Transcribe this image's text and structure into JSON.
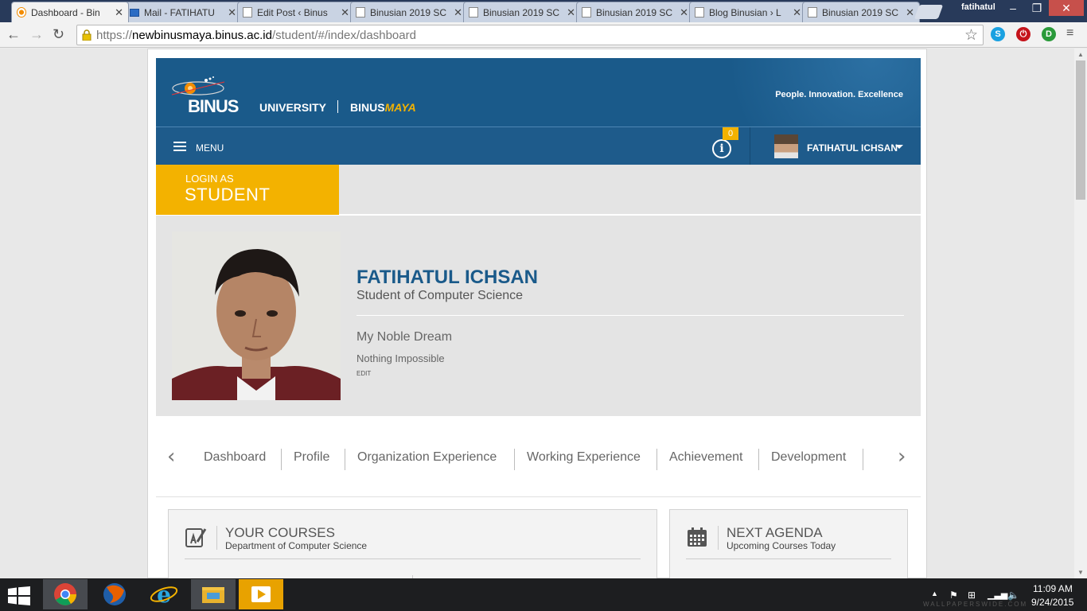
{
  "browser": {
    "tabs": [
      {
        "label": "Dashboard - Bin",
        "icon": "binus-favicon-icon",
        "active": true
      },
      {
        "label": "Mail - FATIHATU",
        "icon": "mail-favicon-icon"
      },
      {
        "label": "Edit Post ‹ Binus",
        "icon": "page-icon"
      },
      {
        "label": "Binusian 2019 SC",
        "icon": "page-icon"
      },
      {
        "label": "Binusian 2019 SC",
        "icon": "page-icon"
      },
      {
        "label": "Binusian 2019 SC",
        "icon": "page-icon"
      },
      {
        "label": "Blog Binusian › L",
        "icon": "page-icon"
      },
      {
        "label": "Binusian 2019 SC",
        "icon": "page-icon"
      }
    ],
    "close_glyph": "✕",
    "profile_name": "fatihatul",
    "url_prefix": "https://",
    "url_host": "newbinusmaya.binus.ac.id",
    "url_path": "/student/#/index/dashboard"
  },
  "site": {
    "brand": "BINUS",
    "brand_suffix": "UNIVERSITY",
    "product_a": "BINUS",
    "product_b": "MAYA",
    "tagline": "People. Innovation. Excellence",
    "accent_color": "#f3b200",
    "primary_color": "#1a5a8a"
  },
  "nav": {
    "menu_label": "MENU",
    "notification_count": "0",
    "info_glyph": "i",
    "user_name": "FATIHATUL ICHSAN"
  },
  "login": {
    "label": "LOGIN AS",
    "role": "STUDENT"
  },
  "profile": {
    "name": "FATIHATUL ICHSAN",
    "major": "Student of Computer Science",
    "dream_heading": "My Noble Dream",
    "dream_text": "Nothing Impossible",
    "edit_label": "EDIT"
  },
  "section_tabs": [
    "Dashboard",
    "Profile",
    "Organization Experience",
    "Working Experience",
    "Achievement",
    "Development"
  ],
  "cards": {
    "courses": {
      "title": "YOUR COURSES",
      "subtitle": "Department of Computer Science"
    },
    "agenda": {
      "title": "NEXT AGENDA",
      "subtitle": "Upcoming Courses Today"
    }
  },
  "taskbar": {
    "time": "11:09 AM",
    "date": "9/24/2015",
    "watermark": "WALLPAPERSWIDE.COM"
  }
}
